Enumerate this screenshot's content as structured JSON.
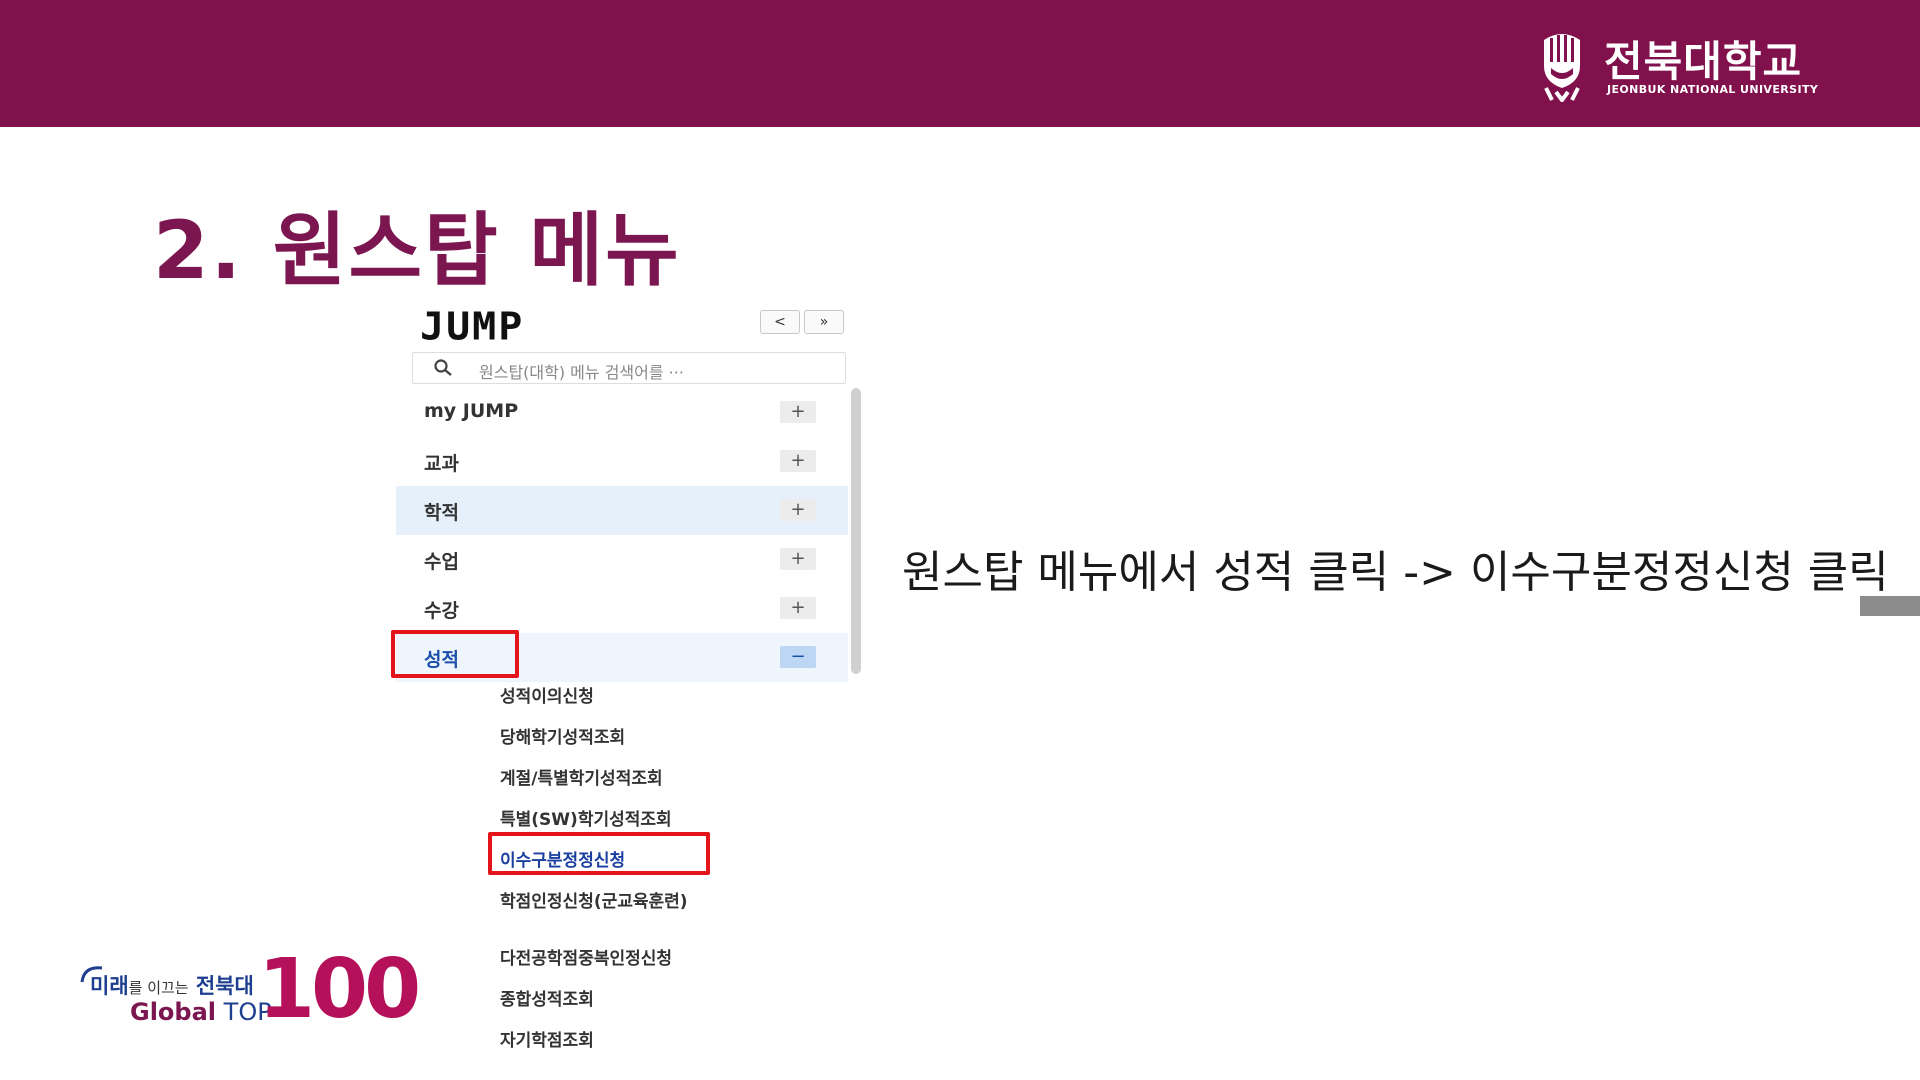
{
  "header": {
    "university_name_ko": "전북대학교",
    "university_name_en": "JEONBUK NATIONAL UNIVERSITY",
    "emblem_icon": "university-emblem-icon",
    "background_color": "#81114c"
  },
  "slide": {
    "title": "2. 원스탑 메뉴",
    "title_color": "#7c1650",
    "instruction": "원스탑 메뉴에서 성적 클릭 -> 이수구분정정신청 클릭"
  },
  "menu": {
    "logo": "JUMP",
    "prev_label": "<",
    "next_label": "»",
    "search_placeholder": "원스탑(대학) 메뉴 검색어를 ···",
    "search_icon": "search-icon",
    "items": [
      {
        "label": "my JUMP",
        "toggle": "+"
      },
      {
        "label": "교과",
        "toggle": "+"
      },
      {
        "label": "학적",
        "toggle": "+"
      },
      {
        "label": "수업",
        "toggle": "+"
      },
      {
        "label": "수강",
        "toggle": "+"
      },
      {
        "label": "성적",
        "toggle": "−"
      }
    ],
    "submenu": [
      "성적이의신청",
      "당해학기성적조회",
      "계절/특별학기성적조회",
      "특별(SW)학기성적조회",
      "이수구분정정신청",
      "학점인정신청(군교육훈련)",
      "다전공학점중복인정신청",
      "종합성적조회",
      "자기학점조회"
    ],
    "highlight_color": "#e3151a"
  },
  "footer": {
    "slogan_part1": "미래",
    "slogan_part2": "를 이끄는",
    "slogan_part3": "전북대",
    "global_word": "Global",
    "top_word": "TOP",
    "number": "100"
  }
}
